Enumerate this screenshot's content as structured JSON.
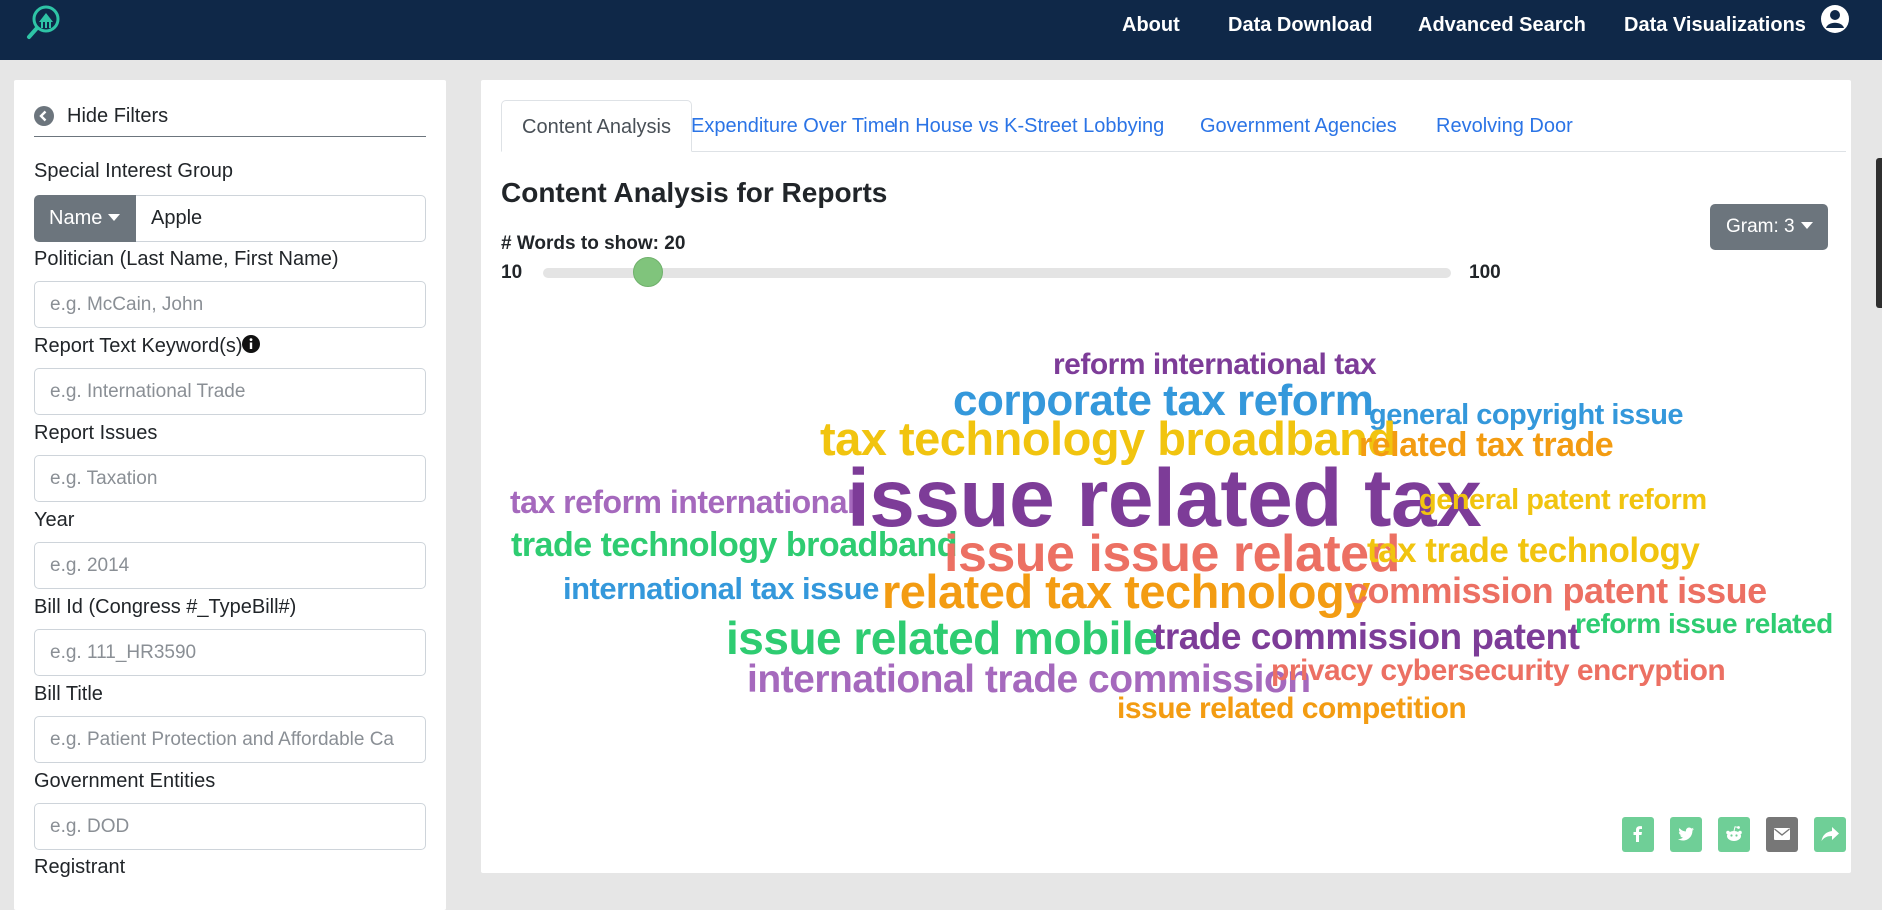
{
  "nav": {
    "links": [
      "About",
      "Data Download",
      "Advanced Search",
      "Data Visualizations"
    ]
  },
  "filters": {
    "hide_label": "Hide Filters",
    "special_interest_label": "Special Interest Group",
    "name_button": "Name",
    "name_value": "Apple",
    "politician_label": "Politician (Last Name, First Name)",
    "politician_placeholder": "e.g. McCain, John",
    "keyword_label": "Report Text Keyword(s)",
    "keyword_placeholder": "e.g. International Trade",
    "issues_label": "Report Issues",
    "issues_placeholder": "e.g. Taxation",
    "year_label": "Year",
    "year_placeholder": "e.g. 2014",
    "bill_id_label": "Bill Id (Congress #_TypeBill#)",
    "bill_id_placeholder": "e.g. 111_HR3590",
    "bill_title_label": "Bill Title",
    "bill_title_placeholder": "e.g. Patient Protection and Affordable Ca",
    "gov_entities_label": "Government Entities",
    "gov_entities_placeholder": "e.g. DOD",
    "registrant_label": "Registrant"
  },
  "tabs": [
    "Content Analysis",
    "Expenditure Over Time",
    "In House vs K-Street Lobbying",
    "Government Agencies",
    "Revolving Door"
  ],
  "main": {
    "title": "Content Analysis for Reports",
    "gram_label": "Gram: 3",
    "words_label": "# Words to show: 20",
    "slider_min": "10",
    "slider_max": "100",
    "slider_value": 20
  },
  "colors": {
    "navbar": "#0f2848",
    "purple": "#7d3c98",
    "blue": "#3498db",
    "yellow": "#f1c40f",
    "orange": "#f39c12",
    "lavender": "#a569bd",
    "green": "#2ecc71",
    "red": "#ec7063",
    "share_green": "#6fcf97",
    "share_gray": "#777777"
  },
  "word_cloud": [
    {
      "text": "reform international tax",
      "color": "#7d3c98"
    },
    {
      "text": "corporate tax reform",
      "color": "#3498db"
    },
    {
      "text": "general copyright issue",
      "color": "#3498db"
    },
    {
      "text": "tax technology broadband",
      "color": "#f1c40f"
    },
    {
      "text": "related tax trade",
      "color": "#f39c12"
    },
    {
      "text": "tax reform international",
      "color": "#a569bd"
    },
    {
      "text": "issue related tax",
      "color": "#7d3c98"
    },
    {
      "text": "general patent reform",
      "color": "#f1c40f"
    },
    {
      "text": "trade technology broadband",
      "color": "#2ecc71"
    },
    {
      "text": "issue issue related",
      "color": "#ec7063"
    },
    {
      "text": "tax trade technology",
      "color": "#f1c40f"
    },
    {
      "text": "international tax issue",
      "color": "#3498db"
    },
    {
      "text": "related tax technology",
      "color": "#f39c12"
    },
    {
      "text": "commission patent issue",
      "color": "#ec7063"
    },
    {
      "text": "issue related mobile",
      "color": "#2ecc71"
    },
    {
      "text": "trade commission patent",
      "color": "#7d3c98"
    },
    {
      "text": "reform issue related",
      "color": "#2ecc71"
    },
    {
      "text": "international trade commission",
      "color": "#a569bd"
    },
    {
      "text": "privacy cybersecurity encryption",
      "color": "#ec7063"
    },
    {
      "text": "issue related competition",
      "color": "#f39c12"
    }
  ],
  "share": [
    "facebook-icon",
    "twitter-icon",
    "reddit-icon",
    "email-icon",
    "share-icon"
  ]
}
